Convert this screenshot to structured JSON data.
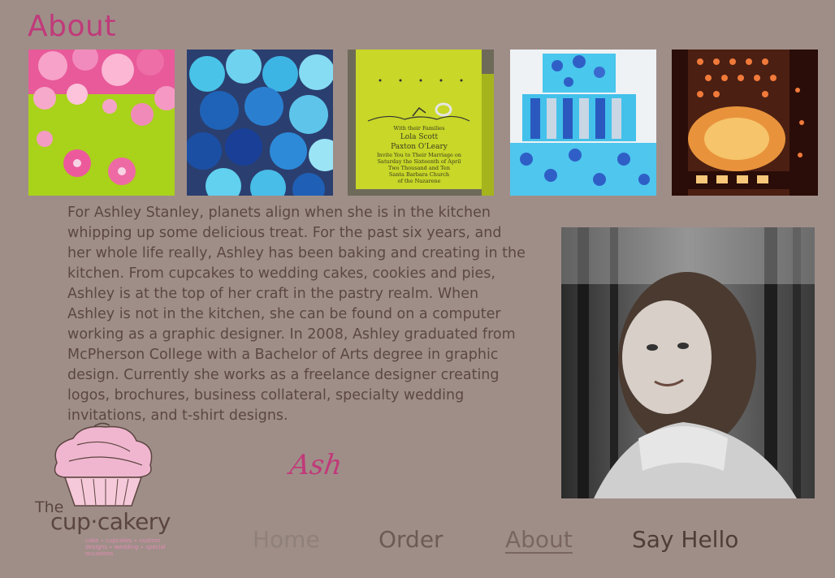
{
  "page": {
    "heading": "About"
  },
  "gallery": {
    "items": [
      {
        "name": "pink-flower-cake-photo"
      },
      {
        "name": "blue-cupcakes-photo"
      },
      {
        "name": "wedding-invitation-photo"
      },
      {
        "name": "polka-dot-tiered-cake-photo"
      },
      {
        "name": "lantern-photo"
      }
    ],
    "invitation_text": [
      "With their Families",
      "Lola Scott",
      "Paxton O'Leary",
      "Invite You to Their Marriage on",
      "Saturday the Sixteenth of April",
      "Two Thousand and Ten",
      "Santa Barbara Church",
      "of the Nazarene"
    ]
  },
  "bio": {
    "text": "For Ashley Stanley, planets align when she is in the kitchen whipping up some delicious treat. For the past six years, and her whole life really, Ashley has been baking and creating in the kitchen. From cupcakes to wedding cakes, cookies and pies, Ashley is at the top of her craft in the pastry realm. When Ashley is not in the kitchen, she can be found on a computer working as a graphic designer. In 2008, Ashley graduated from McPherson College with a Bachelor of Arts degree in graphic design. Currently she works as a freelance designer creating logos, brochures, business collateral, specialty wedding invitations, and t-shirt designs."
  },
  "signature": "Ash",
  "logo": {
    "the": "The",
    "name": "cup·cakery",
    "tagline": "cake ∙ cupcakes ∙ custom designs ∙ wedding ∙ special occasions"
  },
  "nav": {
    "home": "Home",
    "order": "Order",
    "about": "About",
    "say_hello": "Say Hello"
  },
  "colors": {
    "background": "#9f8e88",
    "accent": "#c03a7a",
    "body_text": "#5c4740",
    "logo_pink": "#f0b6cf",
    "logo_brown": "#5b4540"
  }
}
